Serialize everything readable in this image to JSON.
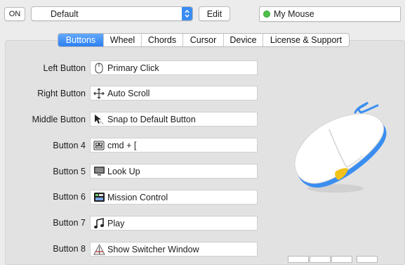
{
  "toolbar": {
    "on_label": "ON",
    "profile_value": "Default",
    "edit_label": "Edit",
    "device_name": "My Mouse"
  },
  "tabs": [
    {
      "label": "Buttons",
      "active": true
    },
    {
      "label": "Wheel"
    },
    {
      "label": "Chords"
    },
    {
      "label": "Cursor"
    },
    {
      "label": "Device"
    },
    {
      "label": "License & Support"
    }
  ],
  "buttons": [
    {
      "label": "Left Button",
      "action": "Primary Click",
      "icon": "mouse-icon"
    },
    {
      "label": "Right Button",
      "action": "Auto Scroll",
      "icon": "move-arrows-icon"
    },
    {
      "label": "Middle Button",
      "action": "Snap to Default Button",
      "icon": "snap-cursor-icon"
    },
    {
      "label": "Button 4",
      "action": "cmd + [",
      "icon": "keyboard-icon"
    },
    {
      "label": "Button 5",
      "action": "Look Up",
      "icon": "monitor-icon"
    },
    {
      "label": "Button 6",
      "action": "Mission Control",
      "icon": "mission-control-icon"
    },
    {
      "label": "Button 7",
      "action": "Play",
      "icon": "music-note-icon"
    },
    {
      "label": "Button 8",
      "action": "Show Switcher Window",
      "icon": "switcher-app-icon"
    }
  ],
  "colors": {
    "accent": "#2b80f4",
    "device_status": "#4ec24a",
    "mouse_accent": "#3a8ef0",
    "mouse_button_highlight": "#f2c21a"
  }
}
